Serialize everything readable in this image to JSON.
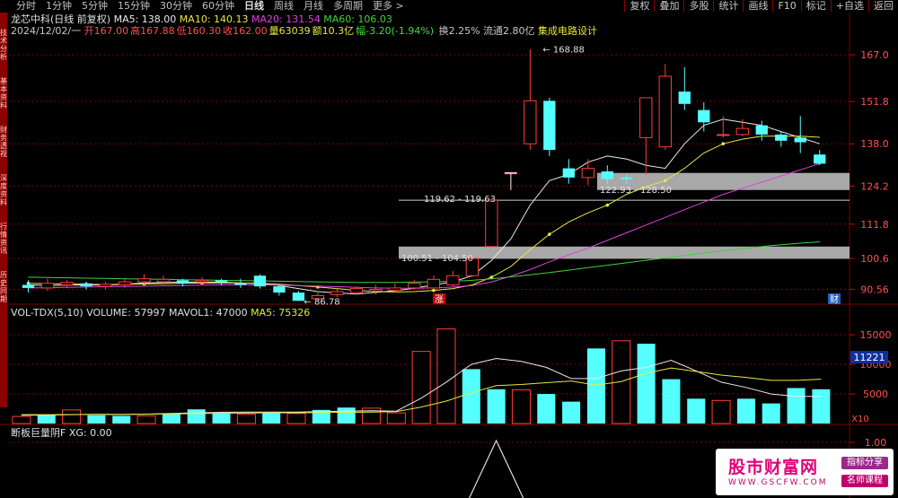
{
  "toolbar": {
    "tabs": [
      "分时",
      "1分钟",
      "5分钟",
      "15分钟",
      "30分钟",
      "60分钟",
      "日线",
      "周线",
      "月线",
      "多周期",
      "更多 >"
    ],
    "active_tab": "日线",
    "tools": [
      "复权",
      "叠加",
      "多股",
      "统计",
      "画线",
      "F10",
      "标记",
      "+自选",
      "返回"
    ]
  },
  "left_strip": [
    "技术分析",
    "基本资料",
    "财务透视",
    "深度资料",
    "行情资讯",
    "历史同期"
  ],
  "header": {
    "stock": "龙芯中科(日线 前复权)",
    "ma": [
      {
        "label": "MA5: 138.00",
        "color": "#e8e8e8"
      },
      {
        "label": "MA10: 140.13",
        "color": "#e8e840"
      },
      {
        "label": "MA20: 131.54",
        "color": "#e040e0"
      },
      {
        "label": "MA60: 106.03",
        "color": "#40d040"
      }
    ],
    "line2_date": "2024/12/02/一",
    "line2_fields": [
      {
        "label": "开",
        "value": "167.00",
        "color": "#ff5050"
      },
      {
        "label": "高",
        "value": "167.88",
        "color": "#ff5050"
      },
      {
        "label": "低",
        "value": "160.30",
        "color": "#ff5050"
      },
      {
        "label": "收",
        "value": "162.00",
        "color": "#ff5050"
      },
      {
        "label": "量",
        "value": "63039",
        "color": "#e8e840"
      },
      {
        "label": "额",
        "value": "10.3亿",
        "color": "#e8e840"
      },
      {
        "label": "幅",
        "value": "-3.20(-1.94%)",
        "color": "#40e040"
      }
    ],
    "line2_extra": "换2.25% 流通2.80亿",
    "sector": "集成电路设计"
  },
  "annotations": {
    "peak": "168.88",
    "low": "86.78",
    "gap1": "119.62 - 119.63",
    "gap2": "122.93 - 128.50",
    "gap3": "100.51 - 104.50",
    "mark_up": "涨",
    "mark_fin": "财"
  },
  "vol_header": {
    "name": "VOL-TDX(5,10)",
    "volume": "VOLUME: 57997",
    "mavol1": "MAVOL1: 47000",
    "ma5": "MA5: 75326"
  },
  "ind_header": {
    "name": "断板巨量阴F",
    "xg": "XG: 0.00"
  },
  "ad": {
    "title": "股市财富网",
    "url": "WWW.GSCFW.COM",
    "badge1": "指标分享",
    "badge2": "名师课程"
  },
  "chart_data": [
    {
      "type": "candlestick",
      "title": "龙芯中科(日线 前复权)",
      "ylim": [
        86.0,
        172.0
      ],
      "yticks": [
        "167.0",
        "151.8",
        "138.0",
        "124.2",
        "111.8",
        "100.6",
        "90.56"
      ],
      "candles": [
        {
          "o": 92.0,
          "c": 91.0,
          "h": 93.5,
          "l": 89.5
        },
        {
          "o": 91.0,
          "c": 92.5,
          "h": 94.0,
          "l": 90.0
        },
        {
          "o": 92.0,
          "c": 92.8,
          "h": 93.5,
          "l": 91.0
        },
        {
          "o": 92.5,
          "c": 91.5,
          "h": 93.0,
          "l": 90.5
        },
        {
          "o": 91.5,
          "c": 92.2,
          "h": 93.0,
          "l": 90.5
        },
        {
          "o": 92.0,
          "c": 93.0,
          "h": 94.0,
          "l": 91.0
        },
        {
          "o": 93.0,
          "c": 94.0,
          "h": 95.5,
          "l": 92.0
        },
        {
          "o": 93.0,
          "c": 93.8,
          "h": 95.0,
          "l": 92.0
        },
        {
          "o": 93.5,
          "c": 92.5,
          "h": 94.0,
          "l": 91.5
        },
        {
          "o": 93.0,
          "c": 93.5,
          "h": 94.5,
          "l": 92.0
        },
        {
          "o": 93.5,
          "c": 92.8,
          "h": 94.0,
          "l": 91.8
        },
        {
          "o": 92.5,
          "c": 92.0,
          "h": 94.0,
          "l": 91.0
        },
        {
          "o": 95.0,
          "c": 91.5,
          "h": 95.5,
          "l": 90.8
        },
        {
          "o": 91.5,
          "c": 89.5,
          "h": 92.0,
          "l": 88.5
        },
        {
          "o": 89.5,
          "c": 86.8,
          "h": 90.0,
          "l": 86.78
        },
        {
          "o": 87.5,
          "c": 88.5,
          "h": 89.5,
          "l": 87.0
        },
        {
          "o": 88.8,
          "c": 89.8,
          "h": 90.8,
          "l": 88.0
        },
        {
          "o": 89.5,
          "c": 90.8,
          "h": 91.5,
          "l": 89.0
        },
        {
          "o": 90.0,
          "c": 90.5,
          "h": 92.0,
          "l": 89.0
        },
        {
          "o": 90.2,
          "c": 91.0,
          "h": 92.5,
          "l": 89.5
        },
        {
          "o": 91.0,
          "c": 92.5,
          "h": 93.5,
          "l": 90.5
        },
        {
          "o": 91.0,
          "c": 93.8,
          "h": 95.0,
          "l": 90.8
        },
        {
          "o": 92.0,
          "c": 95.0,
          "h": 96.5,
          "l": 91.5
        },
        {
          "o": 95.0,
          "c": 100.6,
          "h": 101.5,
          "l": 94.5
        },
        {
          "o": 104.5,
          "c": 119.62,
          "h": 120.0,
          "l": 104.5
        },
        {
          "o": 128.5,
          "c": 128.5,
          "h": 128.5,
          "l": 122.93
        },
        {
          "o": 138.0,
          "c": 152.0,
          "h": 168.88,
          "l": 136.0
        },
        {
          "o": 152.0,
          "c": 136.0,
          "h": 153.0,
          "l": 134.0
        },
        {
          "o": 130.0,
          "c": 127.0,
          "h": 133.0,
          "l": 125.0
        },
        {
          "o": 127.0,
          "c": 130.0,
          "h": 133.0,
          "l": 124.5
        },
        {
          "o": 129.0,
          "c": 126.5,
          "h": 131.0,
          "l": 125.0
        },
        {
          "o": 127.0,
          "c": 126.5,
          "h": 128.0,
          "l": 125.0
        },
        {
          "o": 140.0,
          "c": 153.0,
          "h": 153.0,
          "l": 128.0
        },
        {
          "o": 137.0,
          "c": 160.0,
          "h": 164.0,
          "l": 136.0
        },
        {
          "o": 155.0,
          "c": 151.0,
          "h": 163.0,
          "l": 149.0
        },
        {
          "o": 149.0,
          "c": 145.0,
          "h": 151.5,
          "l": 142.0
        },
        {
          "o": 141.0,
          "c": 141.0,
          "h": 147.0,
          "l": 140.0
        },
        {
          "o": 141.0,
          "c": 143.0,
          "h": 146.0,
          "l": 140.5
        },
        {
          "o": 144.0,
          "c": 141.0,
          "h": 145.5,
          "l": 139.0
        },
        {
          "o": 141.0,
          "c": 139.0,
          "h": 142.0,
          "l": 137.0
        },
        {
          "o": 140.0,
          "c": 138.5,
          "h": 147.0,
          "l": 135.0
        },
        {
          "o": 134.5,
          "c": 131.5,
          "h": 136.0,
          "l": 131.0
        }
      ],
      "series": [
        {
          "name": "MA5",
          "color": "#e8e8e8",
          "values": [
            92.0,
            91.8,
            91.9,
            92.0,
            91.9,
            92.2,
            92.6,
            92.8,
            92.9,
            92.9,
            92.9,
            92.6,
            92.4,
            91.8,
            90.8,
            89.8,
            89.4,
            89.0,
            89.6,
            90.1,
            90.9,
            92.0,
            93.0,
            95.0,
            100.0,
            107.0,
            118.0,
            126.0,
            128.0,
            132.0,
            134.0,
            133.0,
            131.0,
            130.0,
            138.0,
            144.0,
            146.0,
            145.0,
            144.0,
            142.0,
            140.0,
            138.0
          ]
        },
        {
          "name": "MA10",
          "color": "#e8e840",
          "values": [
            92.5,
            92.4,
            92.3,
            92.2,
            92.1,
            92.2,
            92.3,
            92.4,
            92.5,
            92.6,
            92.6,
            92.6,
            92.5,
            92.2,
            91.8,
            91.3,
            90.8,
            90.2,
            89.8,
            89.7,
            89.8,
            90.2,
            90.8,
            92.0,
            94.5,
            98.0,
            103.5,
            108.5,
            112.5,
            115.5,
            118.0,
            121.5,
            124.0,
            126.0,
            130.0,
            135.0,
            138.0,
            139.5,
            140.5,
            140.5,
            140.5,
            140.13
          ]
        },
        {
          "name": "MA20",
          "color": "#e040e0",
          "values": [
            91.0,
            91.1,
            91.2,
            91.3,
            91.4,
            91.5,
            91.6,
            91.7,
            91.8,
            91.9,
            92.0,
            92.0,
            92.0,
            91.9,
            91.8,
            91.6,
            91.4,
            91.2,
            91.0,
            90.9,
            90.9,
            91.0,
            91.3,
            91.8,
            93.0,
            94.8,
            97.0,
            99.5,
            101.8,
            104.0,
            106.5,
            109.0,
            111.5,
            114.0,
            116.5,
            119.0,
            121.5,
            123.5,
            125.5,
            127.5,
            129.5,
            131.54
          ]
        },
        {
          "name": "MA60",
          "color": "#40d040",
          "values": [
            94.5,
            94.4,
            94.3,
            94.2,
            94.1,
            94.0,
            93.9,
            93.8,
            93.7,
            93.6,
            93.5,
            93.4,
            93.3,
            93.2,
            93.1,
            93.0,
            92.9,
            92.8,
            92.8,
            92.8,
            92.9,
            93.0,
            93.2,
            93.5,
            94.0,
            94.6,
            95.3,
            96.0,
            96.8,
            97.6,
            98.4,
            99.2,
            100.0,
            100.8,
            101.6,
            102.4,
            103.1,
            103.8,
            104.5,
            105.1,
            105.6,
            106.03
          ]
        }
      ]
    },
    {
      "type": "bar",
      "title": "VOL-TDX(5,10)",
      "ylim": [
        0,
        17000
      ],
      "yticks": [
        "15000",
        "10000",
        "5000"
      ],
      "y_marker": "11221",
      "values": [
        1200,
        1400,
        2300,
        1400,
        1300,
        1300,
        1700,
        2400,
        1800,
        1600,
        1800,
        1700,
        2300,
        2700,
        2600,
        1800,
        12200,
        16000,
        9200,
        5800,
        5700,
        5000,
        3700,
        12700,
        14000,
        13500,
        7500,
        4200,
        3900,
        4200,
        3400,
        6000,
        5800
      ],
      "up": [
        true,
        false,
        true,
        false,
        false,
        true,
        false,
        false,
        false,
        true,
        false,
        true,
        false,
        false,
        true,
        true,
        true,
        true,
        false,
        false,
        true,
        false,
        false,
        false,
        true,
        false,
        false,
        false,
        true,
        false,
        false,
        false,
        false
      ],
      "series": [
        {
          "name": "MAVOL1",
          "color": "#e8e8e8",
          "values": [
            1400,
            1420,
            1500,
            1550,
            1520,
            1600,
            1700,
            1800,
            1900,
            1950,
            1950,
            1950,
            2000,
            2100,
            2150,
            2100,
            4300,
            7000,
            10000,
            11000,
            10500,
            9500,
            7600,
            7600,
            8900,
            9500,
            10700,
            8900,
            7000,
            6100,
            5000,
            4600,
            4600
          ]
        },
        {
          "name": "MA5",
          "color": "#e8e840",
          "values": [
            1500,
            1500,
            1520,
            1550,
            1560,
            1580,
            1620,
            1680,
            1730,
            1780,
            1800,
            1820,
            1850,
            1900,
            1950,
            2000,
            2800,
            3800,
            5200,
            6400,
            6600,
            6900,
            7200,
            6500,
            7100,
            8500,
            9400,
            8800,
            8200,
            7800,
            7300,
            7300,
            7500
          ]
        }
      ]
    },
    {
      "type": "line",
      "title": "断板巨量阴F",
      "ylim": [
        0,
        1.0
      ],
      "yticks": [
        "1.00"
      ],
      "values": [
        0,
        1,
        0
      ]
    }
  ]
}
